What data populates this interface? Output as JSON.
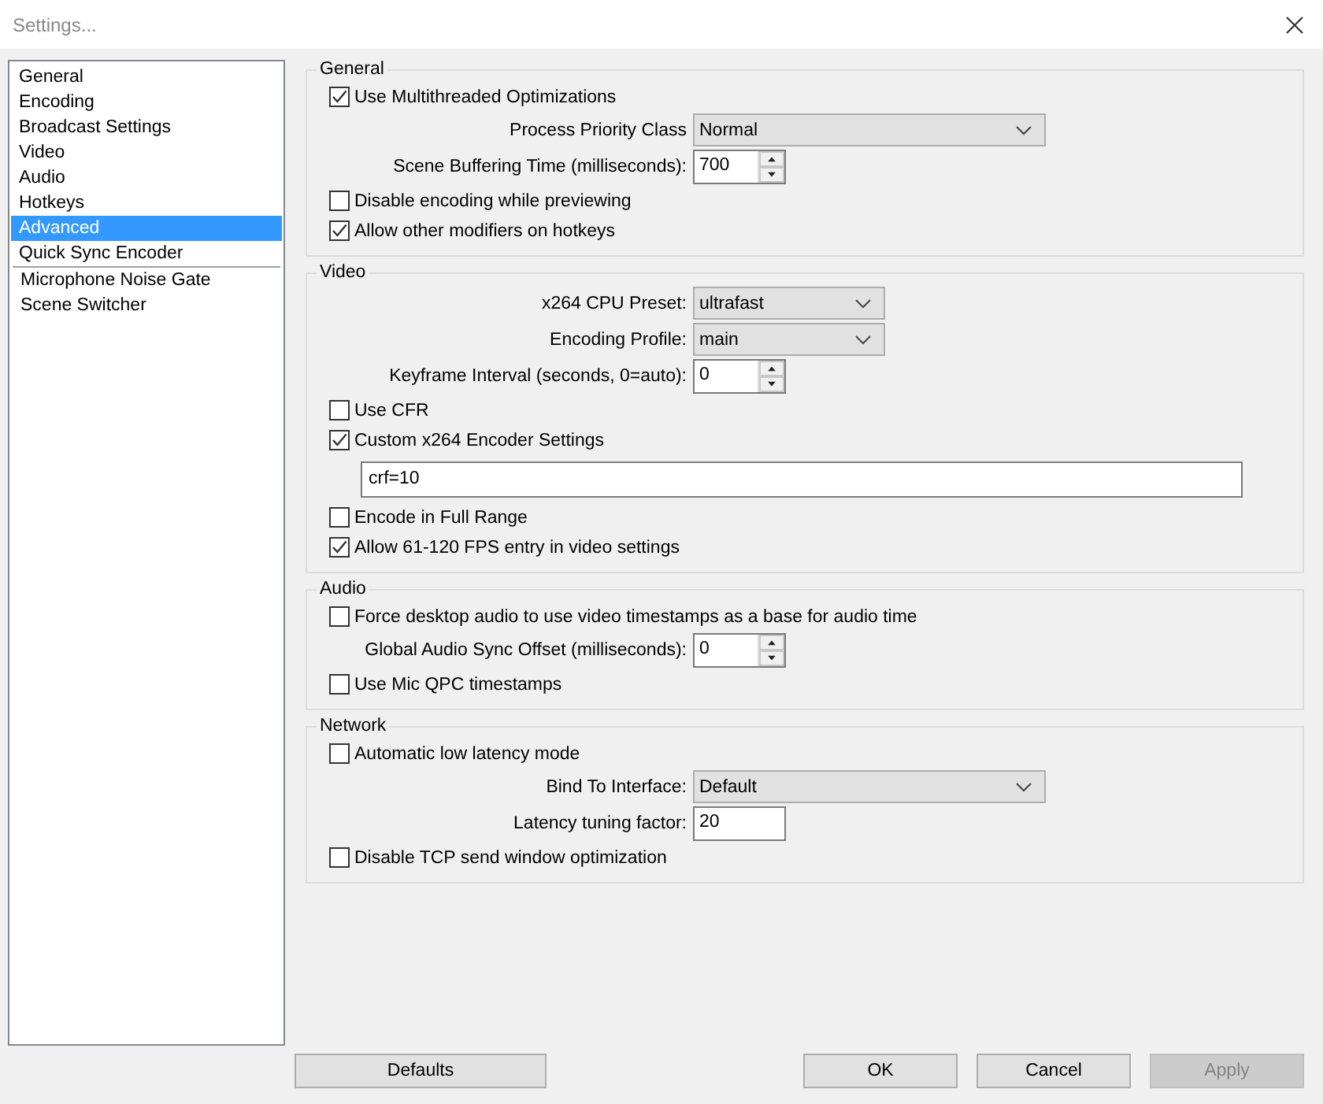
{
  "window": {
    "title": "Settings..."
  },
  "sidebar": {
    "sections": [
      [
        {
          "label": "General",
          "selected": false
        },
        {
          "label": "Encoding",
          "selected": false
        },
        {
          "label": "Broadcast Settings",
          "selected": false
        },
        {
          "label": "Video",
          "selected": false
        },
        {
          "label": "Audio",
          "selected": false
        },
        {
          "label": "Hotkeys",
          "selected": false
        },
        {
          "label": "Advanced",
          "selected": true
        },
        {
          "label": "Quick Sync Encoder",
          "selected": false
        }
      ],
      [
        {
          "label": "Microphone Noise Gate",
          "selected": false
        },
        {
          "label": "Scene Switcher",
          "selected": false
        }
      ]
    ]
  },
  "groups": [
    {
      "title": "General",
      "rows": [
        {
          "kind": "checkbox",
          "label": "Use Multithreaded Optimizations",
          "checked": true
        },
        {
          "kind": "select",
          "label": "Process Priority Class",
          "value": "Normal"
        },
        {
          "kind": "spin",
          "label": "Scene Buffering Time (milliseconds):",
          "value": "700"
        },
        {
          "kind": "checkbox",
          "label": "Disable encoding while previewing",
          "checked": false
        },
        {
          "kind": "checkbox",
          "label": "Allow other modifiers on hotkeys",
          "checked": true
        }
      ]
    },
    {
      "title": "Video",
      "rows": [
        {
          "kind": "select",
          "label": "x264 CPU Preset:",
          "value": "ultrafast"
        },
        {
          "kind": "select",
          "label": "Encoding Profile:",
          "value": "main"
        },
        {
          "kind": "spin",
          "label": "Keyframe Interval (seconds, 0=auto):",
          "value": "0"
        },
        {
          "kind": "checkbox",
          "label": "Use CFR",
          "checked": false
        },
        {
          "kind": "checkbox",
          "label": "Custom x264 Encoder Settings",
          "checked": true
        },
        {
          "kind": "text",
          "value": "crf=10"
        },
        {
          "kind": "checkbox",
          "label": "Encode in Full Range",
          "checked": false
        },
        {
          "kind": "checkbox",
          "label": "Allow 61-120 FPS entry in video settings",
          "checked": true
        }
      ]
    },
    {
      "title": "Audio",
      "rows": [
        {
          "kind": "checkbox",
          "label": "Force desktop audio to use video timestamps as a base for audio time",
          "checked": false
        },
        {
          "kind": "spin",
          "label": "Global Audio Sync Offset (milliseconds):",
          "value": "0"
        },
        {
          "kind": "checkbox",
          "label": "Use Mic QPC timestamps",
          "checked": false
        }
      ]
    },
    {
      "title": "Network",
      "rows": [
        {
          "kind": "checkbox",
          "label": "Automatic low latency mode",
          "checked": false
        },
        {
          "kind": "select",
          "label": "Bind To Interface:",
          "value": "Default"
        },
        {
          "kind": "number",
          "label": "Latency tuning factor:",
          "value": "20"
        },
        {
          "kind": "checkbox",
          "label": "Disable TCP send window optimization",
          "checked": false
        }
      ]
    }
  ],
  "defaults_button": {
    "label": "Defaults",
    "disabled": false
  },
  "buttons": [
    {
      "label": "OK",
      "disabled": false
    },
    {
      "label": "Cancel",
      "disabled": false
    },
    {
      "label": "Apply",
      "disabled": true
    }
  ]
}
